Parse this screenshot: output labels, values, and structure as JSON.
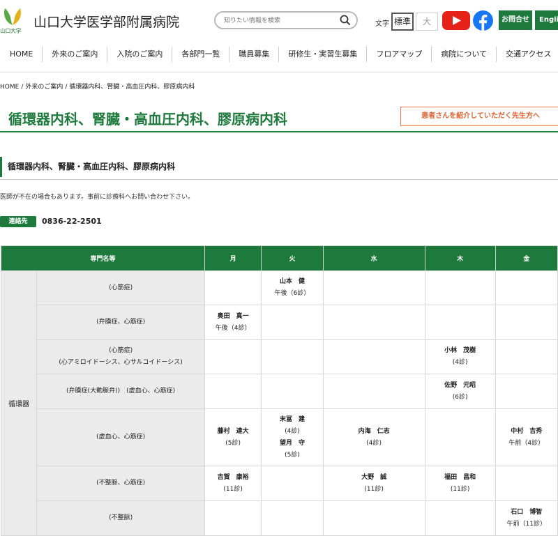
{
  "header": {
    "logo_text": "山口大学",
    "site_title": "山口大学医学部附属病院",
    "search": {
      "placeholder": "知りたい情報を検索"
    },
    "font_size_label": "文字",
    "font_size_standard": "標準",
    "font_size_large": "大",
    "contact_label": "お問合せ",
    "english_label": "English"
  },
  "nav": {
    "items": [
      {
        "label": "HOME"
      },
      {
        "label": "外来のご案内"
      },
      {
        "label": "入院のご案内"
      },
      {
        "label": "各部門一覧"
      },
      {
        "label": "職員募集"
      },
      {
        "label": "研修生・実習生募集"
      },
      {
        "label": "フロアマップ"
      },
      {
        "label": "病院について"
      },
      {
        "label": "交通アクセス"
      }
    ]
  },
  "breadcrumb": {
    "items": [
      "HOME",
      "外来のご案内",
      "循環器内科、腎臓・高血圧内科、膠原病内科"
    ],
    "separator": "/"
  },
  "page": {
    "title": "循環器内科、腎臓・高血圧内科、膠原病内科",
    "referral_button": "患者さんを紹介していただく先生方へ",
    "section_heading": "循環器内科、腎臓・高血圧内科、膠原病内科",
    "notice": "医師が不在の場合もあります。事前に診療科へお問い合わせ下さい。",
    "contact_badge": "連絡先",
    "contact_phone": "0836-22-2501"
  },
  "table": {
    "headers": {
      "specialty": "専門名等",
      "mon": "月",
      "tue": "火",
      "wed": "水",
      "thu": "木",
      "fri": "金"
    },
    "category": "循環器",
    "rows": [
      {
        "spec": [
          "(心筋症)"
        ],
        "mon": [],
        "tue": [
          {
            "name": "山本　健",
            "slot": "午後（6診）",
            "inline": true
          }
        ],
        "wed": [],
        "thu": [],
        "fri": []
      },
      {
        "spec": [
          "(弁膜症、心筋症)"
        ],
        "mon": [
          {
            "name": "奥田　真一",
            "slot": "午後（4診）",
            "inline": true
          }
        ],
        "tue": [],
        "wed": [],
        "thu": [],
        "fri": []
      },
      {
        "spec": [
          "(心筋症)",
          "(心アミロイドーシス、心サルコイドーシス)"
        ],
        "mon": [],
        "tue": [],
        "wed": [],
        "thu": [
          {
            "name": "小林　茂樹",
            "slot": "(4診)"
          }
        ],
        "fri": []
      },
      {
        "spec": [
          "(弁膜症(大動脈弁))　(虚血心、心筋症)"
        ],
        "mon": [],
        "tue": [],
        "wed": [],
        "thu": [
          {
            "name": "佐野　元昭",
            "slot": "(6診)"
          }
        ],
        "fri": []
      },
      {
        "spec": [
          "(虚血心、心筋症)"
        ],
        "mon": [
          {
            "name": "藤村　達大",
            "slot": "(5診)"
          }
        ],
        "tue": [
          {
            "name": "末冨　建",
            "slot": "(4診)"
          },
          {
            "name": "望月　守",
            "slot": "(5診)"
          }
        ],
        "wed": [
          {
            "name": "内海　仁志",
            "slot": "(4診)"
          }
        ],
        "thu": [],
        "fri": [
          {
            "name": "中村　吉秀",
            "slot": "午前（4診）",
            "inline": true
          }
        ]
      },
      {
        "spec": [
          "(不整脈、心筋症)"
        ],
        "mon": [
          {
            "name": "吉賀　康裕",
            "slot": "(11診)"
          }
        ],
        "tue": [],
        "wed": [
          {
            "name": "大野　誠",
            "slot": "(11診)"
          }
        ],
        "thu": [
          {
            "name": "福田　昌和",
            "slot": "(11診)"
          }
        ],
        "fri": []
      },
      {
        "spec": [
          "(不整脈)"
        ],
        "mon": [],
        "tue": [],
        "wed": [],
        "thu": [],
        "fri": [
          {
            "name": "石口　博智",
            "slot": "午前（11診）",
            "inline": true
          }
        ]
      }
    ]
  },
  "colors": {
    "brand_green": "#1d7a3c",
    "referral_orange": "#e0612f",
    "cell_gray": "#ebebeb"
  },
  "icons": {
    "search": "search-icon",
    "youtube": "youtube-icon",
    "facebook": "facebook-icon",
    "logo": "hospital-logo-icon"
  }
}
